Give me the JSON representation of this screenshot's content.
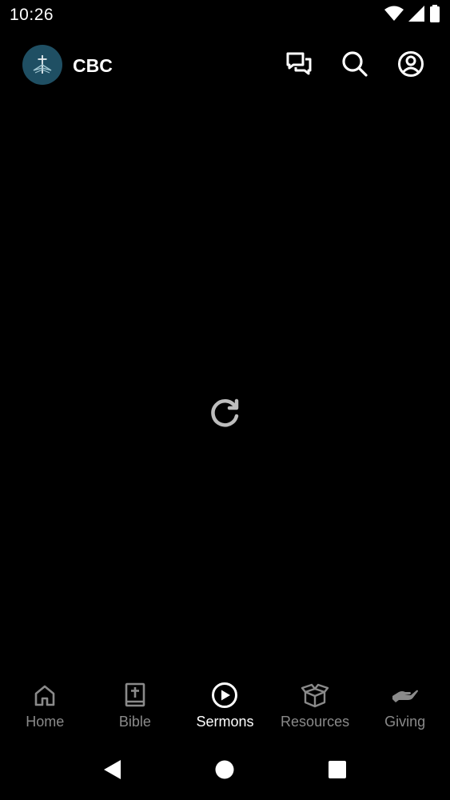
{
  "status_bar": {
    "time": "10:26",
    "icons": [
      "wifi-icon",
      "cellular-signal-icon",
      "battery-icon"
    ]
  },
  "app_bar": {
    "title": "CBC",
    "logo": "church-logo",
    "actions": [
      "chat-icon",
      "search-icon",
      "account-icon"
    ]
  },
  "main": {
    "reload_icon": "reload-icon"
  },
  "bottom_nav": {
    "items": [
      {
        "label": "Home",
        "icon": "home-icon",
        "active": false
      },
      {
        "label": "Bible",
        "icon": "bible-icon",
        "active": false
      },
      {
        "label": "Sermons",
        "icon": "play-circle-icon",
        "active": true
      },
      {
        "label": "Resources",
        "icon": "box-icon",
        "active": false
      },
      {
        "label": "Giving",
        "icon": "giving-hand-icon",
        "active": false
      }
    ]
  },
  "system_nav": [
    "back-icon",
    "home-circle-icon",
    "recents-icon"
  ],
  "colors": {
    "background": "#000000",
    "logo_bg": "#1f4f63",
    "active": "#ffffff",
    "inactive": "#8a8a8a",
    "reload": "#bdbdbd"
  }
}
